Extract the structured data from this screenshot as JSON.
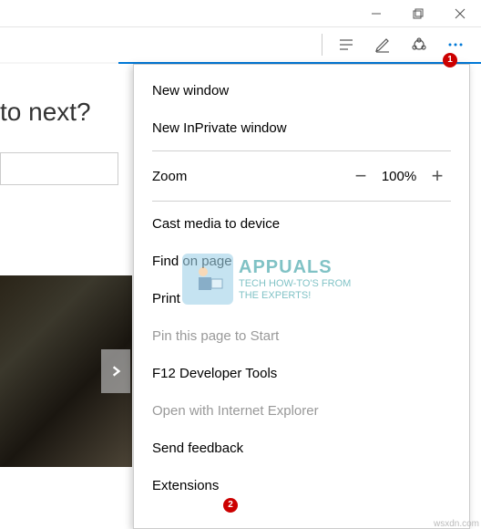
{
  "window_controls": {
    "minimize": "minimize",
    "maximize": "maximize",
    "close": "close"
  },
  "toolbar": {
    "reading": "reading-view",
    "notes": "web-notes",
    "share": "share",
    "more": "more"
  },
  "page_behind": {
    "heading": "to next?",
    "arrow": "next"
  },
  "menu": {
    "new_window": "New window",
    "new_inprivate": "New InPrivate window",
    "zoom_label": "Zoom",
    "zoom_minus": "−",
    "zoom_value": "100%",
    "zoom_plus": "+",
    "cast": "Cast media to device",
    "find": "Find on page",
    "print": "Print",
    "pin": "Pin this page to Start",
    "f12": "F12 Developer Tools",
    "open_ie": "Open with Internet Explorer",
    "feedback": "Send feedback",
    "extensions": "Extensions"
  },
  "annotations": {
    "badge1": "1",
    "badge2": "2"
  },
  "watermark": {
    "brand": "APPUALS",
    "tagline1": "TECH HOW-TO'S FROM",
    "tagline2": "THE EXPERTS!"
  },
  "footer": "wsxdn.com"
}
